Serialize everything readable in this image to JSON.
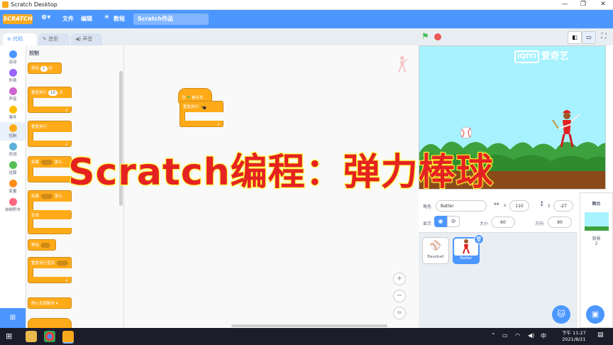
{
  "window": {
    "title": "Scratch Desktop",
    "minimize": "—",
    "maximize": "❐",
    "close": "✕"
  },
  "menubar": {
    "logo": "SCRATCH",
    "globe": "⊕▾",
    "file": "文件",
    "edit": "编辑",
    "tutorials": "教程",
    "project_name": "Scratch作品"
  },
  "tabs": {
    "code": "代码",
    "costumes": "造型",
    "sounds": "声音"
  },
  "categories": [
    {
      "label": "运动",
      "color": "#4c97ff"
    },
    {
      "label": "外观",
      "color": "#9966ff"
    },
    {
      "label": "声音",
      "color": "#cf63cf"
    },
    {
      "label": "事件",
      "color": "#ffbf00"
    },
    {
      "label": "控制",
      "color": "#ffab19"
    },
    {
      "label": "侦测",
      "color": "#5cb1d6"
    },
    {
      "label": "运算",
      "color": "#59c059"
    },
    {
      "label": "变量",
      "color": "#ff8c1a"
    },
    {
      "label": "自制积木",
      "color": "#ff6680"
    }
  ],
  "palette": {
    "title": "控制",
    "wait": {
      "pre": "等待",
      "value": "1",
      "post": "秒"
    },
    "repeat": {
      "pre": "重复执行",
      "value": "10",
      "post": "次"
    },
    "forever": "重复执行",
    "if_then": {
      "pre": "如果",
      "post": "那么"
    },
    "if_else": {
      "pre": "如果",
      "post": "那么",
      "else": "否则"
    },
    "wait_until": "等待",
    "repeat_until": "重复执行直到",
    "stop": {
      "pre": "停止",
      "value": "全部脚本 ▾"
    }
  },
  "script": {
    "hat_pre": "当",
    "hat_post": "被点击",
    "forever": "重复执行"
  },
  "zoom": {
    "in": "+",
    "out": "−",
    "reset": "="
  },
  "stage": {
    "watermark_box": "iQIYI",
    "watermark_text": "爱奇艺"
  },
  "sprite_info": {
    "sprite_label": "角色",
    "sprite_name": "Batter",
    "x_label": "x",
    "x_value": "110",
    "y_label": "y",
    "y_value": "-27",
    "show_label": "显示",
    "size_label": "大小",
    "size_value": "60",
    "direction_label": "方向",
    "direction_value": "90"
  },
  "sprites": [
    {
      "name": "Baseball"
    },
    {
      "name": "Batter"
    }
  ],
  "stage_panel": {
    "title": "舞台",
    "backdrops_label": "背景",
    "backdrops_count": "2"
  },
  "overlay_title": "Scratch编程：弹力棒球",
  "taskbar": {
    "time": "下午 11:27",
    "date": "2021/8/21",
    "ime": "中"
  }
}
